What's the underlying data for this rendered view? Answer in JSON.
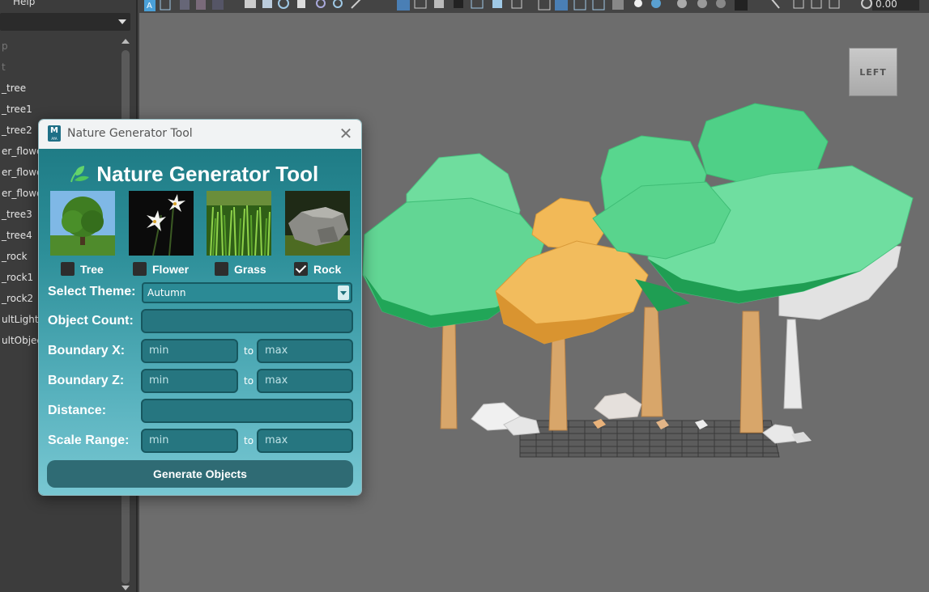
{
  "menu": {
    "help": "Help"
  },
  "outliner": {
    "items": [
      "p",
      "t",
      "_tree",
      "_tree1",
      "_tree2",
      "er_flowe",
      "er_flowe",
      "er_flowe",
      "_tree3",
      "_tree4",
      "_rock",
      "_rock1",
      "_rock2",
      "ultLightS",
      "ultObjec"
    ]
  },
  "toolbar": {
    "value": "0.00"
  },
  "viewcube": {
    "label": "LEFT"
  },
  "tool": {
    "window_title": "Nature Generator Tool",
    "app_icon_letter": "M",
    "app_icon_sub": "AYA",
    "heading": "Nature Generator Tool",
    "objects": [
      {
        "label": "Tree",
        "checked": false,
        "image_icon": "tree-photo"
      },
      {
        "label": "Flower",
        "checked": false,
        "image_icon": "flower-photo"
      },
      {
        "label": "Grass",
        "checked": false,
        "image_icon": "grass-photo"
      },
      {
        "label": "Rock",
        "checked": true,
        "image_icon": "rock-photo"
      }
    ],
    "theme_label": "Select Theme:",
    "theme_value": "Autumn",
    "count_label": "Object Count:",
    "boundary_x_label": "Boundary X:",
    "boundary_z_label": "Boundary Z:",
    "distance_label": "Distance:",
    "scale_label": "Scale Range:",
    "min_placeholder": "min",
    "max_placeholder": "max",
    "to_label": "to",
    "generate_label": "Generate Objects"
  },
  "colors": {
    "panel_top": "#1f7c86",
    "panel_bottom": "#79c8d3",
    "tree_green": "#3dcf7c",
    "tree_autumn": "#f0b450",
    "trunk": "#d8a66a",
    "viewport_bg": "#6d6d6d"
  }
}
